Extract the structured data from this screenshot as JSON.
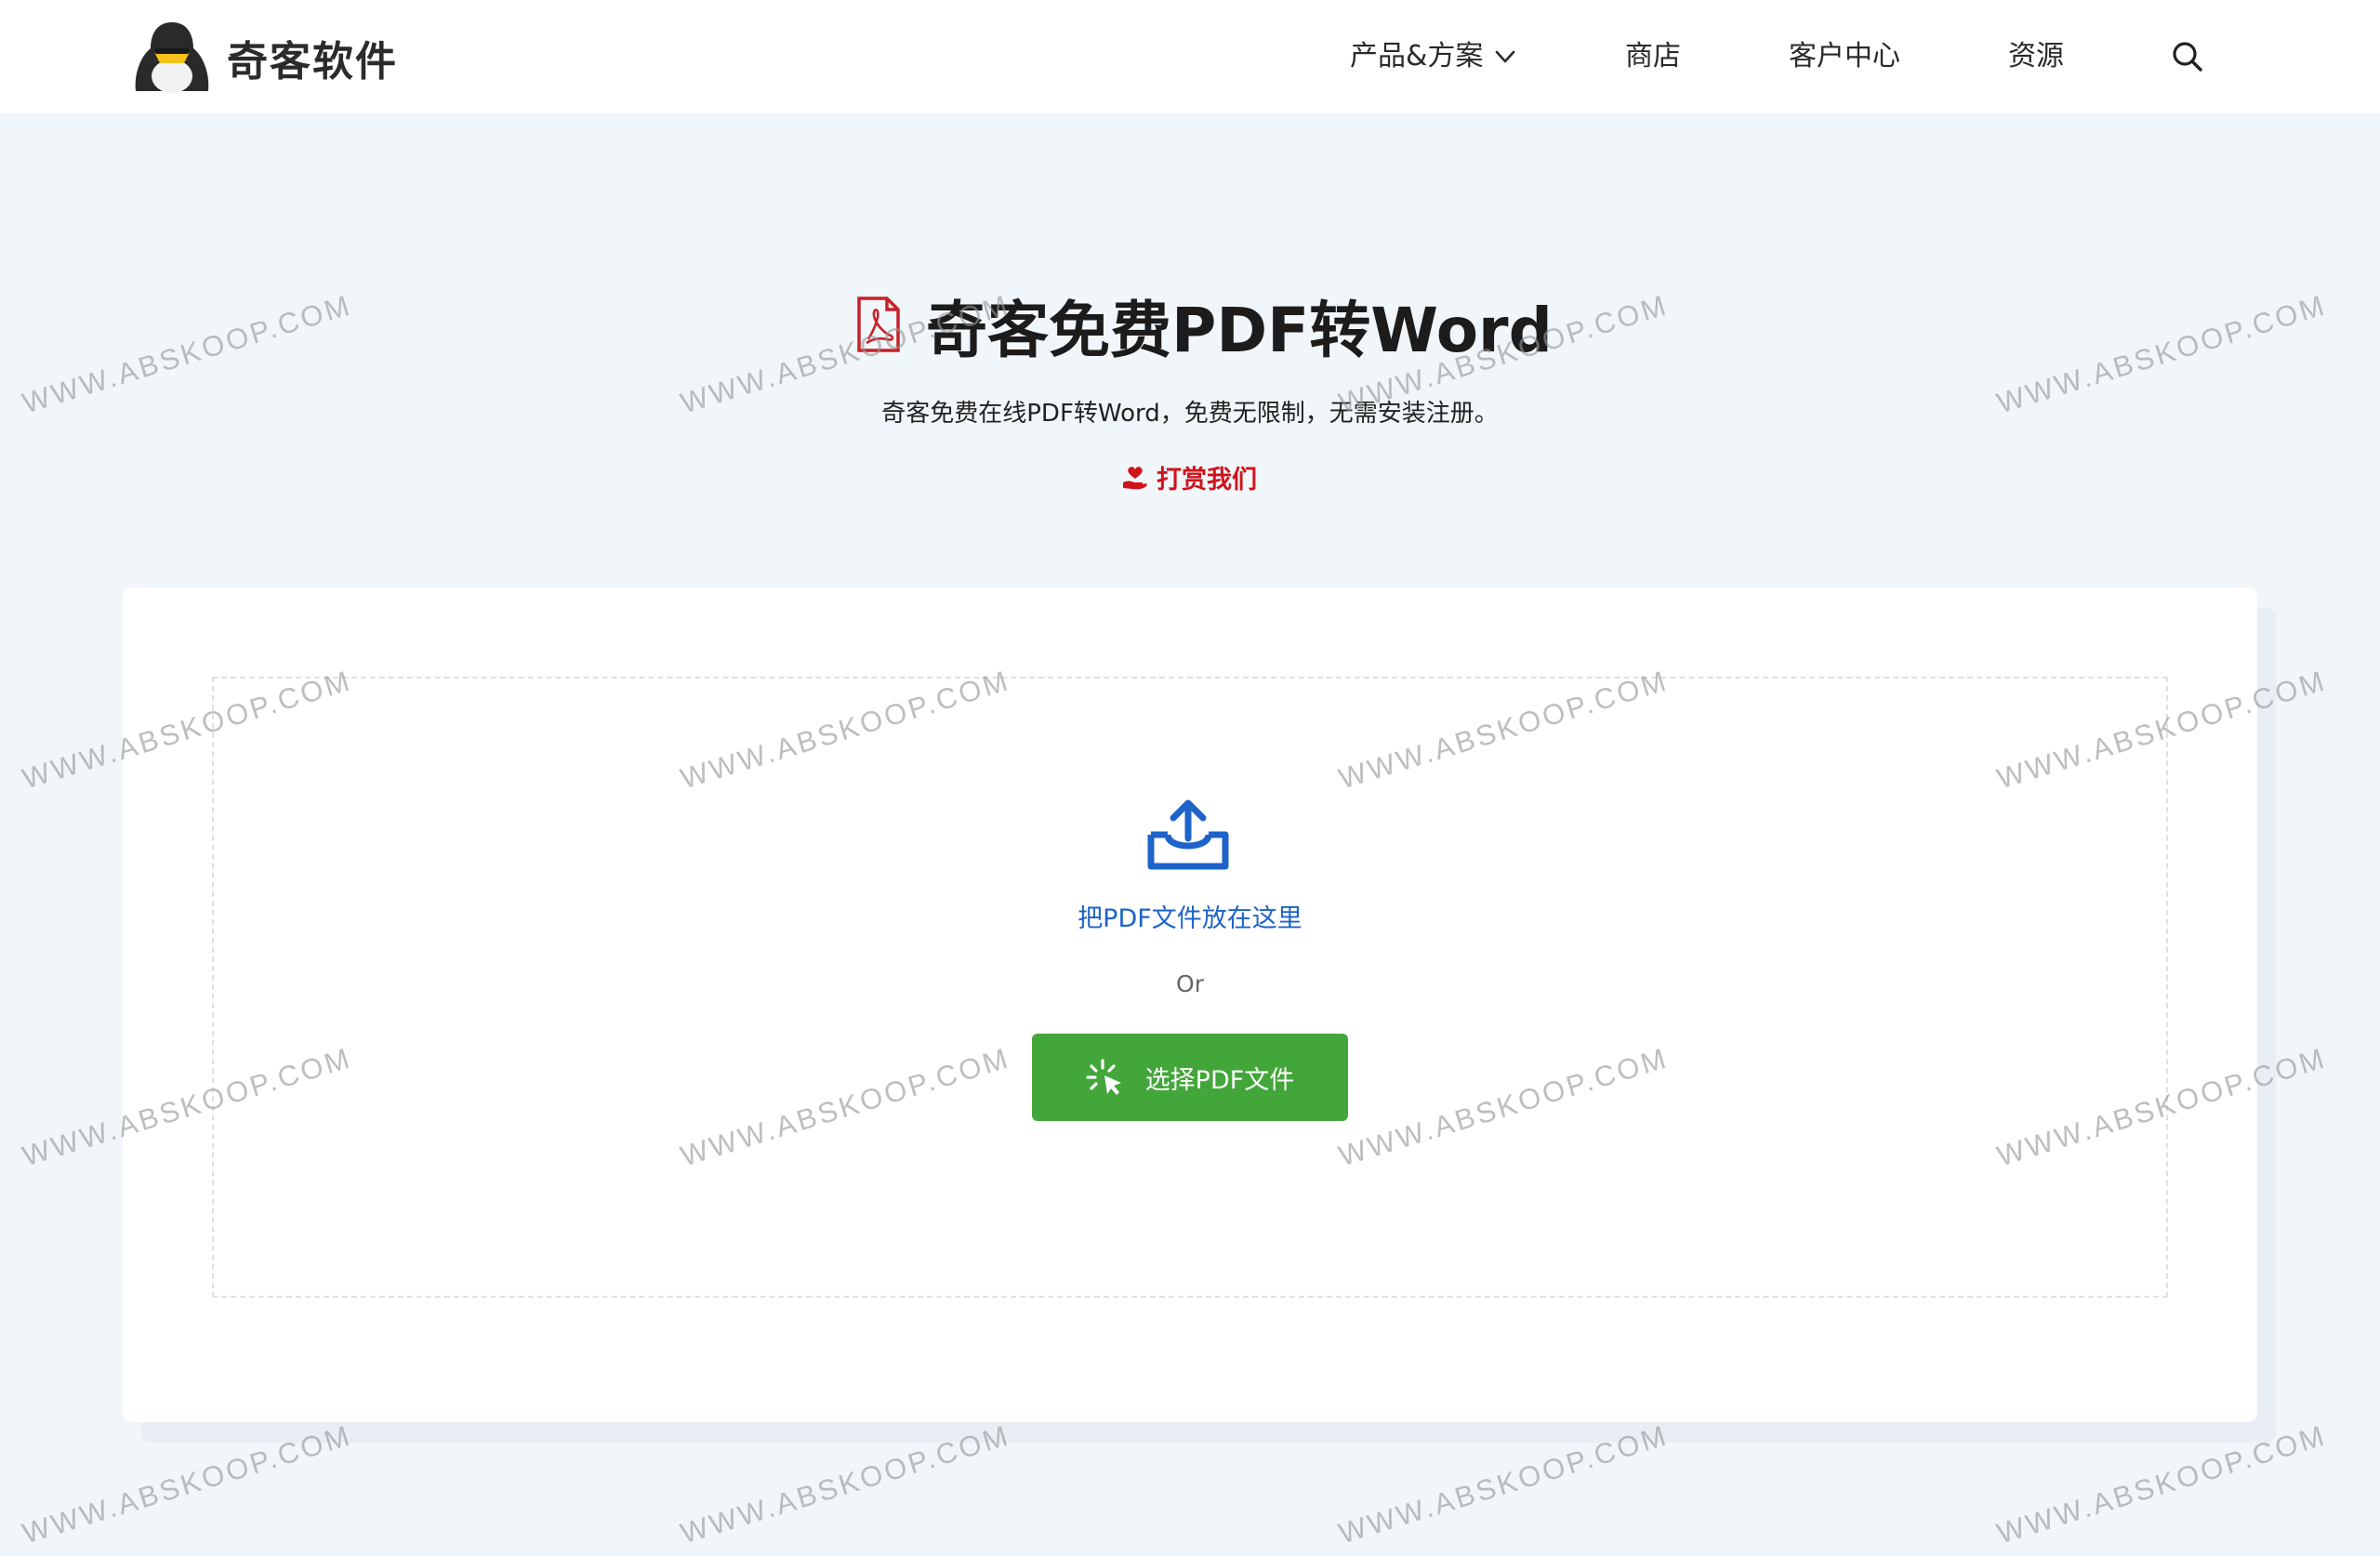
{
  "header": {
    "brand_name": "奇客软件",
    "nav": {
      "products": "产品&方案",
      "store": "商店",
      "customer_center": "客户中心",
      "resources": "资源"
    }
  },
  "hero": {
    "title": "奇客免费PDF转Word",
    "subtitle": "奇客免费在线PDF转Word，免费无限制，无需安装注册。",
    "reward": "打赏我们"
  },
  "upload": {
    "drop_text": "把PDF文件放在这里",
    "or_text": "Or",
    "choose_button": "选择PDF文件"
  },
  "watermark": {
    "text": "WWW.ABSKOOP.COM"
  },
  "colors": {
    "accent_blue": "#1d63c9",
    "button_green": "#43a63a",
    "reward_red": "#d0121b",
    "page_bg": "#f1f6fa"
  },
  "icons": [
    "logo-penguin-icon",
    "chevron-down-icon",
    "search-icon",
    "pdf-file-icon",
    "heart-hand-icon",
    "upload-tray-icon",
    "cursor-click-icon"
  ]
}
